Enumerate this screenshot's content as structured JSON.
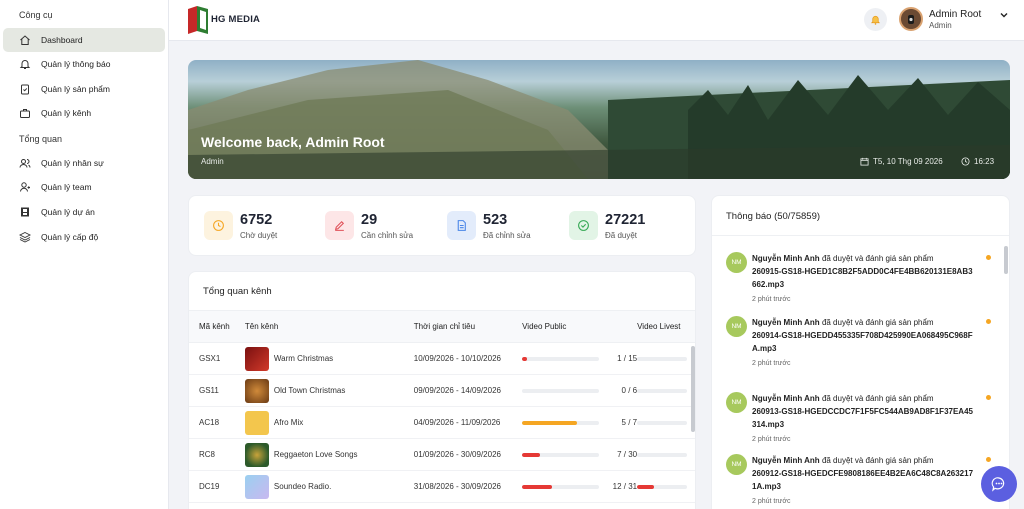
{
  "sidebar": {
    "section_tools": "Công cụ",
    "section_overview": "Tổng quan",
    "items": [
      {
        "label": "Dashboard"
      },
      {
        "label": "Quản lý thông báo"
      },
      {
        "label": "Quản lý sản phẩm"
      },
      {
        "label": "Quản lý kênh"
      },
      {
        "label": "Quản lý nhân sự"
      },
      {
        "label": "Quản lý team"
      },
      {
        "label": "Quản lý dự án"
      },
      {
        "label": "Quản lý cấp độ"
      }
    ]
  },
  "header": {
    "brand": "HG MEDIA",
    "user_name": "Admin Root",
    "user_role": "Admin"
  },
  "banner": {
    "welcome": "Welcome back, Admin Root",
    "role": "Admin",
    "date": "T5, 10 Thg 09 2026",
    "time": "16:23"
  },
  "stats": [
    {
      "value": "6752",
      "label": "Chờ duyệt",
      "color": "#f5a623"
    },
    {
      "value": "29",
      "label": "Cần chỉnh sửa",
      "color": "#e0525a"
    },
    {
      "value": "523",
      "label": "Đã chỉnh sửa",
      "color": "#4a86e8"
    },
    {
      "value": "27221",
      "label": "Đã duyệt",
      "color": "#34a853"
    }
  ],
  "channels": {
    "title": "Tổng quan kênh",
    "columns": [
      "Mã kênh",
      "Tên kênh",
      "Thời gian chỉ tiêu",
      "Video Public",
      "Video Livest"
    ],
    "rows": [
      {
        "code": "GSX1",
        "name": "Warm Christmas",
        "period": "10/09/2026 - 10/10/2026",
        "public": "1 / 15",
        "public_ratio": 0.0667,
        "live_ratio": 0
      },
      {
        "code": "GS11",
        "name": "Old Town Christmas",
        "period": "09/09/2026 - 14/09/2026",
        "public": "0 / 6",
        "public_ratio": 0,
        "live_ratio": 0
      },
      {
        "code": "AC18",
        "name": "Afro Mix",
        "period": "04/09/2026 - 11/09/2026",
        "public": "5 / 7",
        "public_ratio": 0.714,
        "live_ratio": 0
      },
      {
        "code": "RC8",
        "name": "Reggaeton Love Songs",
        "period": "01/09/2026 - 30/09/2026",
        "public": "7 / 30",
        "public_ratio": 0.233,
        "live_ratio": 0
      },
      {
        "code": "DC19",
        "name": "Soundeo Radio.",
        "period": "31/08/2026 - 30/09/2026",
        "public": "12 / 31",
        "public_ratio": 0.387,
        "live_ratio": 0.33
      }
    ]
  },
  "notifications": {
    "title": "Thông báo (50/75859)",
    "items": [
      {
        "initials": "NM",
        "name": "Nguyễn Minh Anh",
        "action": "đã duyệt và đánh giá sản phẩm",
        "file": "260915-GS18-HGED1C8B2F5ADD0C4FE4BB620131E8AB3662.mp3",
        "time": "2 phút trước"
      },
      {
        "initials": "NM",
        "name": "Nguyễn Minh Anh",
        "action": "đã duyệt và đánh giá sản phẩm",
        "file": "260914-GS18-HGEDD455335F708D425990EA068495C968FA.mp3",
        "time": "2 phút trước"
      },
      {
        "initials": "NM",
        "name": "Nguyễn Minh Anh",
        "action": "đã duyệt và đánh giá sản phẩm",
        "file": "260913-GS18-HGEDCCDC7F1F5FC544AB9AD8F1F37EA45314.mp3",
        "time": "2 phút trước"
      },
      {
        "initials": "NM",
        "name": "Nguyễn Minh Anh",
        "action": "đã duyệt và đánh giá sản phẩm",
        "file": "260912-GS18-HGEDCFE9808186EE4B2EA6C48C8A2632171A.mp3",
        "time": "2 phút trước"
      }
    ]
  }
}
